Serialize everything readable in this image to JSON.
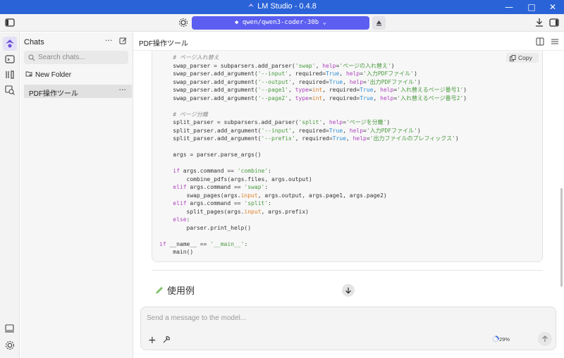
{
  "window": {
    "title": "LM Studio - 0.4.8",
    "minimize": "—",
    "maximize": "□",
    "close": "✕"
  },
  "toolbar": {
    "model": "qwen/qwen3-coder-30b",
    "model_chevron": "⌄",
    "accent": "#5b5ef0"
  },
  "rail": {
    "items": [
      "chat-icon",
      "terminal-icon",
      "models-icon",
      "search-models-icon"
    ],
    "bottom": [
      "device-icon",
      "settings-icon"
    ]
  },
  "chats": {
    "title": "Chats",
    "more": "···",
    "search_placeholder": "Search chats...",
    "new_folder": "New Folder",
    "items": [
      {
        "label": "PDF操作ツール",
        "more": "···"
      }
    ]
  },
  "main": {
    "title": "PDF操作ツール",
    "copy_label": "Copy",
    "code_lines": [
      [
        [
          "    ",
          ""
        ],
        [
          "# ページ入れ替え",
          "c-com"
        ]
      ],
      [
        [
          "    swap_parser = subparsers.add_parser(",
          ""
        ],
        [
          "'swap'",
          "c-str"
        ],
        [
          ", ",
          ""
        ],
        [
          "help",
          "c-kwarg"
        ],
        [
          "=",
          ""
        ],
        [
          "'ページの入れ替え'",
          "c-str"
        ],
        [
          ")",
          ""
        ]
      ],
      [
        [
          "    swap_parser.add_argument(",
          ""
        ],
        [
          "'--input'",
          "c-str"
        ],
        [
          ", required=",
          ""
        ],
        [
          "True",
          "c-bool"
        ],
        [
          ", ",
          ""
        ],
        [
          "help",
          "c-kwarg"
        ],
        [
          "=",
          ""
        ],
        [
          "'入力PDFファイル'",
          "c-str"
        ],
        [
          ")",
          ""
        ]
      ],
      [
        [
          "    swap_parser.add_argument(",
          ""
        ],
        [
          "'--output'",
          "c-str"
        ],
        [
          ", required=",
          ""
        ],
        [
          "True",
          "c-bool"
        ],
        [
          ", ",
          ""
        ],
        [
          "help",
          "c-kwarg"
        ],
        [
          "=",
          ""
        ],
        [
          "'出力PDFファイル'",
          "c-str"
        ],
        [
          ")",
          ""
        ]
      ],
      [
        [
          "    swap_parser.add_argument(",
          ""
        ],
        [
          "'--page1'",
          "c-str"
        ],
        [
          ", ",
          ""
        ],
        [
          "type",
          "c-kwarg"
        ],
        [
          "=",
          ""
        ],
        [
          "int",
          "c-type"
        ],
        [
          ", required=",
          ""
        ],
        [
          "True",
          "c-bool"
        ],
        [
          ", ",
          ""
        ],
        [
          "help",
          "c-kwarg"
        ],
        [
          "=",
          ""
        ],
        [
          "'入れ替えるページ番号1'",
          "c-str"
        ],
        [
          ")",
          ""
        ]
      ],
      [
        [
          "    swap_parser.add_argument(",
          ""
        ],
        [
          "'--page2'",
          "c-str"
        ],
        [
          ", ",
          ""
        ],
        [
          "type",
          "c-kwarg"
        ],
        [
          "=",
          ""
        ],
        [
          "int",
          "c-type"
        ],
        [
          ", required=",
          ""
        ],
        [
          "True",
          "c-bool"
        ],
        [
          ", ",
          ""
        ],
        [
          "help",
          "c-kwarg"
        ],
        [
          "=",
          ""
        ],
        [
          "'入れ替えるページ番号2'",
          "c-str"
        ],
        [
          ")",
          ""
        ]
      ],
      [
        [
          "",
          ""
        ]
      ],
      [
        [
          "    ",
          ""
        ],
        [
          "# ページ分離",
          "c-com"
        ]
      ],
      [
        [
          "    split_parser = subparsers.add_parser(",
          ""
        ],
        [
          "'split'",
          "c-str"
        ],
        [
          ", ",
          ""
        ],
        [
          "help",
          "c-kwarg"
        ],
        [
          "=",
          ""
        ],
        [
          "'ページを分離'",
          "c-str"
        ],
        [
          ")",
          ""
        ]
      ],
      [
        [
          "    split_parser.add_argument(",
          ""
        ],
        [
          "'--input'",
          "c-str"
        ],
        [
          ", required=",
          ""
        ],
        [
          "True",
          "c-bool"
        ],
        [
          ", ",
          ""
        ],
        [
          "help",
          "c-kwarg"
        ],
        [
          "=",
          ""
        ],
        [
          "'入力PDFファイル'",
          "c-str"
        ],
        [
          ")",
          ""
        ]
      ],
      [
        [
          "    split_parser.add_argument(",
          ""
        ],
        [
          "'--prefix'",
          "c-str"
        ],
        [
          ", required=",
          ""
        ],
        [
          "True",
          "c-bool"
        ],
        [
          ", ",
          ""
        ],
        [
          "help",
          "c-kwarg"
        ],
        [
          "=",
          ""
        ],
        [
          "'出力ファイルのプレフィックス'",
          "c-str"
        ],
        [
          ")",
          ""
        ]
      ],
      [
        [
          "",
          ""
        ]
      ],
      [
        [
          "    args = parser.parse_args()",
          ""
        ]
      ],
      [
        [
          "",
          ""
        ]
      ],
      [
        [
          "    ",
          ""
        ],
        [
          "if",
          "c-kw"
        ],
        [
          " args.command == ",
          ""
        ],
        [
          "'combine'",
          "c-str"
        ],
        [
          ":",
          ""
        ]
      ],
      [
        [
          "        combine_pdfs(args.files, args.output)",
          ""
        ]
      ],
      [
        [
          "    ",
          ""
        ],
        [
          "elif",
          "c-kw"
        ],
        [
          " args.command == ",
          ""
        ],
        [
          "'swap'",
          "c-str"
        ],
        [
          ":",
          ""
        ]
      ],
      [
        [
          "        swap_pages(args.",
          ""
        ],
        [
          "input",
          "c-type"
        ],
        [
          ", args.output, args.page1, args.page2)",
          ""
        ]
      ],
      [
        [
          "    ",
          ""
        ],
        [
          "elif",
          "c-kw"
        ],
        [
          " args.command == ",
          ""
        ],
        [
          "'split'",
          "c-str"
        ],
        [
          ":",
          ""
        ]
      ],
      [
        [
          "        split_pages(args.",
          ""
        ],
        [
          "input",
          "c-type"
        ],
        [
          ", args.prefix)",
          ""
        ]
      ],
      [
        [
          "    ",
          ""
        ],
        [
          "else",
          "c-kw"
        ],
        [
          ":",
          ""
        ]
      ],
      [
        [
          "        parser.print_help()",
          ""
        ]
      ],
      [
        [
          "",
          ""
        ]
      ],
      [
        [
          "",
          ""
        ],
        [
          "if",
          "c-kw"
        ],
        [
          " __name__ == ",
          ""
        ],
        [
          "'__main__'",
          "c-str"
        ],
        [
          ":",
          ""
        ]
      ],
      [
        [
          "    main()",
          ""
        ]
      ]
    ],
    "section_heading": "使用例"
  },
  "composer": {
    "placeholder": "Send a message to the model...",
    "plus": "+",
    "context_usage": "29%",
    "context_fraction": 0.29
  }
}
